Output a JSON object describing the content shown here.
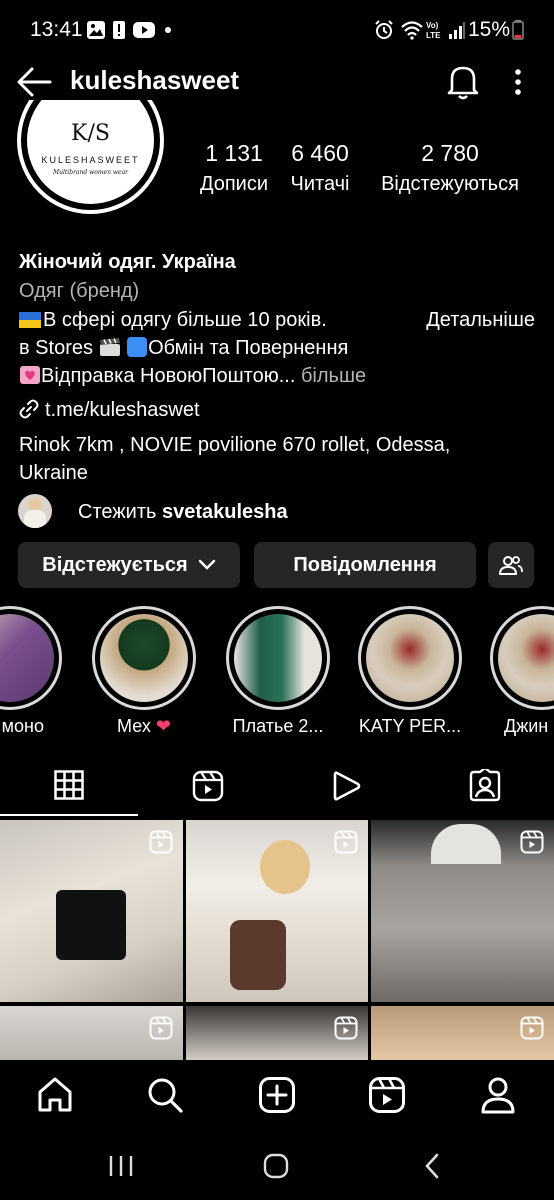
{
  "status_bar": {
    "time": "13:41",
    "battery": "15%",
    "icons": [
      "gallery-icon",
      "alert-icon",
      "youtube-icon",
      "dot-icon",
      "alarm-icon",
      "wifi-icon",
      "volte-icon",
      "signal-icon",
      "battery-icon"
    ]
  },
  "header": {
    "username": "kuleshasweet",
    "icons": [
      "back-arrow-icon",
      "bell-icon",
      "more-vertical-icon"
    ]
  },
  "avatar": {
    "monogram": "K/S",
    "brand": "KULESHASWEET",
    "tagline": "Multibrand women wear"
  },
  "stats": [
    {
      "value": "1 131",
      "label": "Дописи"
    },
    {
      "value": "6 460",
      "label": "Читачі"
    },
    {
      "value": "2 780",
      "label": "Відстежуються"
    }
  ],
  "bio": {
    "name": "Жіночий одяг. Україна",
    "category": "Одяг (бренд)",
    "line1": "В сфері одягу більше 10 років.",
    "more_details": "Детальніше",
    "line2_prefix": "в Stores",
    "line2_text": "Обмін та Повернення",
    "line3": "Відправка НовоюПоштою...",
    "more": "більше",
    "link": "t.me/kuleshaswet",
    "address": "Rinok 7km , NOVIE  povilione 670 rollet, Odessa,",
    "address2": "Ukraine",
    "followed_by_prefix": "Стежить",
    "followed_by_user": "svetakulesha"
  },
  "buttons": {
    "following": "Відстежується",
    "message": "Повідомлення"
  },
  "highlights": [
    {
      "label": "моно"
    },
    {
      "label": "Мех"
    },
    {
      "label": "Платье 2..."
    },
    {
      "label": "KATY PER..."
    },
    {
      "label": "Джин"
    }
  ],
  "tabs": [
    "grid-icon",
    "reels-icon",
    "video-icon",
    "tagged-icon"
  ],
  "bottom_nav": [
    "home-icon",
    "search-icon",
    "create-icon",
    "reels-icon",
    "profile-icon"
  ],
  "system_nav": [
    "recents-icon",
    "home-circle-icon",
    "back-chevron-icon"
  ]
}
